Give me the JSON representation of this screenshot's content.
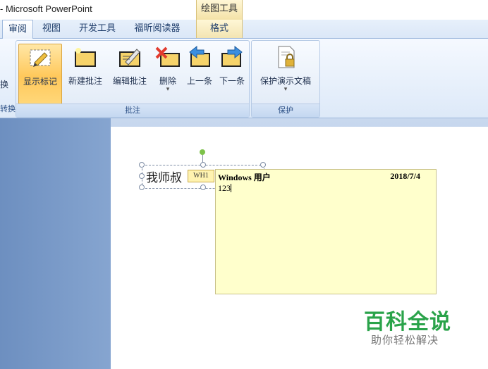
{
  "window": {
    "title": "- Microsoft PowerPoint",
    "context_tool": "绘图工具"
  },
  "tabs": [
    {
      "label": "审阅",
      "active": true
    },
    {
      "label": "视图"
    },
    {
      "label": "开发工具"
    },
    {
      "label": "福昕阅读器"
    },
    {
      "label": "格式",
      "context": true
    }
  ],
  "ribbon": {
    "left_partial_button": "换",
    "left_partial_group": "转换",
    "comments_group": {
      "label": "批注",
      "buttons": [
        {
          "label": "显示标记",
          "icon": "show-markup-icon",
          "active": true
        },
        {
          "label": "新建批注",
          "icon": "new-comment-icon"
        },
        {
          "label": "编辑批注",
          "icon": "edit-comment-icon"
        },
        {
          "label": "删除",
          "icon": "delete-comment-icon",
          "dropdown": "▾"
        },
        {
          "label": "上一条",
          "icon": "previous-comment-icon"
        },
        {
          "label": "下一条",
          "icon": "next-comment-icon"
        }
      ]
    },
    "protect_group": {
      "label": "保护",
      "buttons": [
        {
          "label": "保护演示文稿",
          "icon": "protect-presentation-icon",
          "dropdown": "▾"
        }
      ]
    }
  },
  "slide": {
    "text": "我师叔",
    "comment_marker": "WH1",
    "comment": {
      "author": "Windows 用户",
      "date": "2018/7/4",
      "text": "123"
    }
  },
  "watermark": {
    "title": "百科全说",
    "subtitle": "助你轻松解决"
  },
  "colors": {
    "ribbon_bg": "#dde9f8",
    "active_button": "#ffc85a",
    "comment_bg": "#ffffcc",
    "watermark_green": "#2aa34a"
  }
}
